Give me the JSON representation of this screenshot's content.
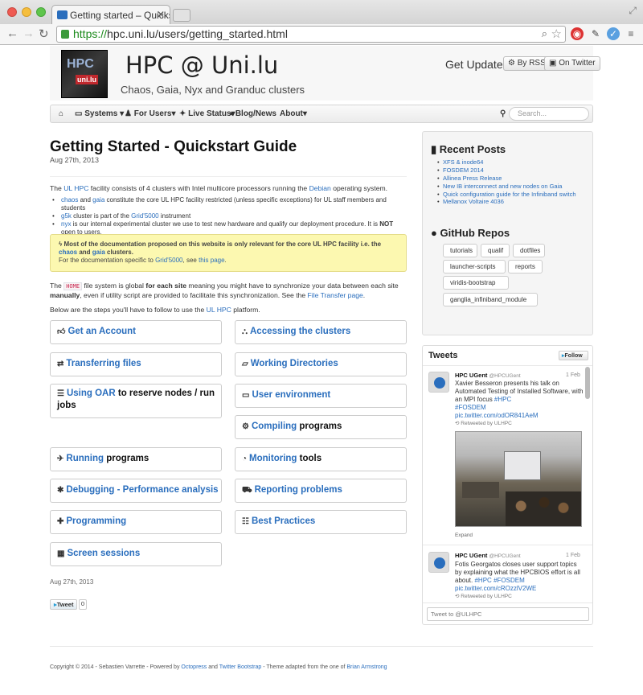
{
  "browser": {
    "tab_title": "Getting started – Quickstar",
    "url_scheme": "https://",
    "url_rest": "hpc.uni.lu/users/getting_started.html"
  },
  "site": {
    "logo_top": "HPC",
    "logo_bottom": "uni.lu",
    "title": "HPC @ Uni.lu",
    "subtitle": "Chaos, Gaia, Nyx and Granduc clusters",
    "updates_label": "Get Updates:",
    "rss_label": "By RSS",
    "twitter_label": "On Twitter"
  },
  "nav": {
    "home_icon": "home-icon",
    "items": [
      "Systems",
      "For Users",
      "Live Status",
      "Blog/News",
      "About"
    ],
    "search_placeholder": "Search..."
  },
  "main": {
    "title": "Getting Started - Quickstart Guide",
    "date": "Aug 27th, 2013",
    "intro": {
      "pre": "The ",
      "link1": "UL HPC",
      "mid": " facility consists of 4 clusters with Intel multicore processors running the ",
      "link2": "Debian",
      "post": " operating system."
    },
    "bullets": {
      "b1_link1": "chaos",
      "b1_and": " and ",
      "b1_link2": "gaia",
      "b1_text": " constitute the core UL HPC facility restricted (unless specific exceptions) for UL staff members and students",
      "b2_link": "g5k",
      "b2_text": " cluster is part of the ",
      "b2_link2": "Grid'5000",
      "b2_text2": " instrument",
      "b3_link": "nyx",
      "b3_text": " is our internal experimental cluster we use to test new hardware and qualify our deployment procedure. It is ",
      "b3_bold": "NOT",
      "b3_text2": " open to users."
    },
    "alert": {
      "line1": "Most of the documentation proposed on this website is only relevant for the core UL HPC facility i.e. the",
      "link_chaos": "chaos",
      "and": " and ",
      "link_gaia": "gaia",
      "clusters": " clusters.",
      "line2_pre": "For the documentation specific to ",
      "link_grid": "Grid'5000",
      "line2_mid": ", see ",
      "link_page": "this page",
      "line2_end": "."
    },
    "para2": {
      "pre": "The ",
      "code": "HOME",
      "mid1": " file system is global ",
      "bold1": "for each site",
      "mid2": " meaning you might have to synchronize your data between each site ",
      "bold2": "manually",
      "mid3": ", even if utility script are provided to facilitate this synchronization. See the ",
      "link": "File Transfer page",
      "end": "."
    },
    "para3": {
      "pre": "Below are the steps you'll have to follow to use the ",
      "link": "UL HPC",
      "end": " platform."
    },
    "cards": [
      {
        "link": "Get an Account",
        "rest": ""
      },
      {
        "link": "Accessing the clusters",
        "rest": ""
      },
      {
        "link": "Transferring files",
        "rest": ""
      },
      {
        "link": "Working Directories",
        "rest": ""
      },
      {
        "link": "Using OAR",
        "rest": " to reserve nodes / run jobs"
      },
      {
        "link": "User environment",
        "rest": ""
      },
      {
        "link": "Compiling",
        "rest": " programs"
      },
      {
        "link": "Running",
        "rest": " programs"
      },
      {
        "link": "Monitoring",
        "rest": " tools"
      },
      {
        "link": "Debugging - Performance analysis",
        "rest": ""
      },
      {
        "link": "Reporting problems",
        "rest": ""
      },
      {
        "link": "Programming",
        "rest": ""
      },
      {
        "link": "Best Practices",
        "rest": ""
      },
      {
        "link": "Screen sessions",
        "rest": ""
      }
    ],
    "footer_date": "Aug 27th, 2013",
    "tweet_label": "Tweet",
    "tweet_count": "0"
  },
  "sidebar": {
    "recent_title": "Recent Posts",
    "posts": [
      "XFS & inode64",
      "FOSDEM 2014",
      "Allinea Press Release",
      "New IB interconnect and new nodes on Gaia",
      "Quick configuration guide for the Infiniband switch",
      "Mellanox Voltaire 4036"
    ],
    "repos_title": "GitHub Repos",
    "repos": [
      "tutorials",
      "qualif",
      "dotfiles",
      "launcher-scripts",
      "reports",
      "viridis-bootstrap",
      "ganglia_infiniband_module"
    ]
  },
  "tweets": {
    "title": "Tweets",
    "follow_label": "Follow",
    "t1": {
      "author": "HPC UGent",
      "handle": "@HPCUGent",
      "date": "1 Feb",
      "text": "Xavier Besseron presents his talk on Automated Testing of Installed Software, with an MPI focus",
      "tag1": "#HPC",
      "tag2": "#FOSDEM",
      "link": "pic.twitter.com/odOR841AeM",
      "rt": "Retweeted by ULHPC",
      "expand": "Expand"
    },
    "t2": {
      "author": "HPC UGent",
      "handle": "@HPCUGent",
      "date": "1 Feb",
      "text": "Fotis Georgatos closes user support topics by explaining what the HPCBIOS effort is all about.",
      "tag1": "#HPC",
      "tag2": "#FOSDEM",
      "link": "pic.twitter.com/cROzzlV2WE",
      "rt": "Retweeted by ULHPC"
    },
    "input_placeholder": "Tweet to @ULHPC"
  },
  "footer": {
    "pre": "Copyright © 2014 - Sebastien Varrette - Powered by ",
    "link1": "Octopress",
    "and": " and ",
    "link2": "Twitter Bootstrap",
    "mid": " - Theme adapted from the one of ",
    "link3": "Brian Armstrong"
  }
}
